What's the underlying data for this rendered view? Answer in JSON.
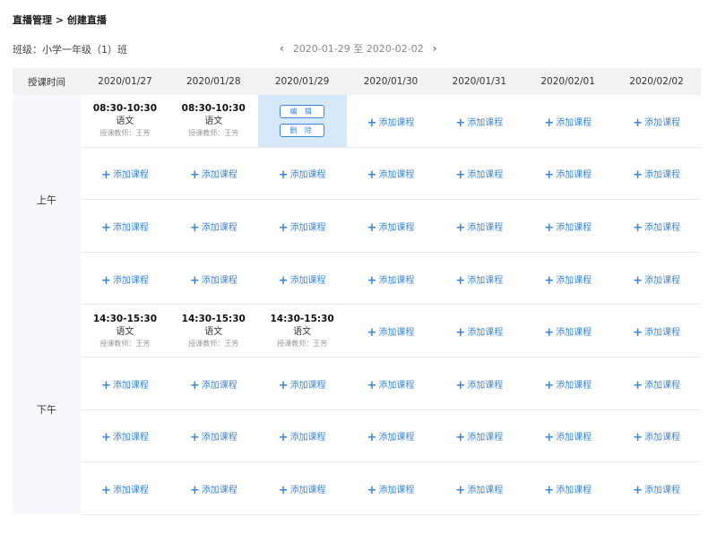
{
  "breadcrumb": {
    "root": "直播管理",
    "separator": " > ",
    "current": "创建直播"
  },
  "class_label": "班级：小学一年级（1）班",
  "date_range": {
    "prev_icon": "chevron-left-icon",
    "text": "2020-01-29 至 2020-02-02",
    "next_icon": "chevron-right-icon"
  },
  "table": {
    "time_header": "授课时间",
    "dates": [
      "2020/01/27",
      "2020/01/28",
      "2020/01/29",
      "2020/01/30",
      "2020/01/31",
      "2020/02/01",
      "2020/02/02"
    ],
    "periods": [
      "上午",
      "下午"
    ],
    "add_label": "添加课程",
    "edit_label": "编 辑",
    "delete_label": "删 除",
    "morning_courses": [
      {
        "time": "08:30-10:30",
        "subject": "语文",
        "teacher": "授课教师：王芳"
      },
      {
        "time": "08:30-10:30",
        "subject": "语文",
        "teacher": "授课教师：王芳"
      }
    ],
    "afternoon_courses": [
      {
        "time": "14:30-15:30",
        "subject": "语文",
        "teacher": "授课教师：王芳"
      },
      {
        "time": "14:30-15:30",
        "subject": "语文",
        "teacher": "授课教师：王芳"
      },
      {
        "time": "14:30-15:30",
        "subject": "语文",
        "teacher": "授课教师：王芳"
      }
    ]
  },
  "colors": {
    "accent": "#3a86d6",
    "selected_bg": "#d6e9fa",
    "header_bg": "#f2f2f2",
    "period_bg": "#f6f8fb"
  }
}
